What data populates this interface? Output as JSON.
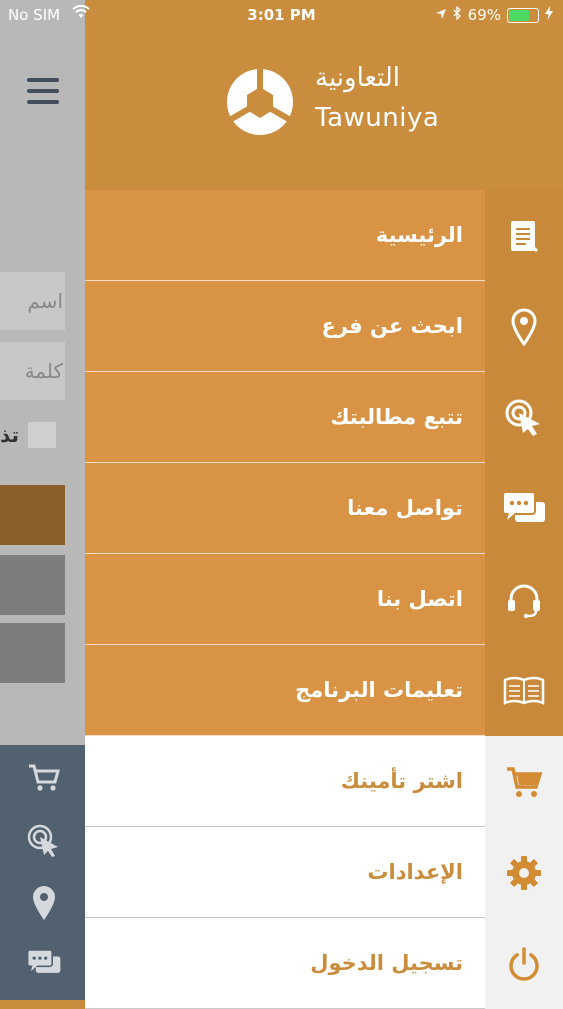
{
  "status": {
    "carrier": "No SIM",
    "time": "3:01 PM",
    "battery": "69%",
    "battery_level": 0.69
  },
  "logo": {
    "arabic": "التعاونية",
    "english": "Tawuniya"
  },
  "underlay": {
    "username_placeholder": "اسم",
    "password_placeholder": "كلمة",
    "remember_text": "تذ",
    "icons": [
      "cart-icon",
      "tap-icon",
      "location-icon",
      "chat-icon"
    ]
  },
  "menu": {
    "items": [
      {
        "label": "الرئيسية",
        "icon": "document-icon"
      },
      {
        "label": "ابحث عن فرع",
        "icon": "location-icon"
      },
      {
        "label": "تتبع مطالبتك",
        "icon": "tap-icon"
      },
      {
        "label": "تواصل معنا",
        "icon": "chat-icon"
      },
      {
        "label": "اتصل بنا",
        "icon": "headset-icon"
      },
      {
        "label": "تعليمات البرنامج",
        "icon": "book-icon"
      },
      {
        "label": "اشتر تأمينك",
        "icon": "cart-icon"
      },
      {
        "label": "الإعدادات",
        "icon": "gear-icon"
      },
      {
        "label": "تسجيل الدخول",
        "icon": "power-icon"
      }
    ]
  },
  "colors": {
    "accent": "#d89444",
    "accent_dark": "#c98d3d",
    "underlay_bar": "#526170"
  }
}
